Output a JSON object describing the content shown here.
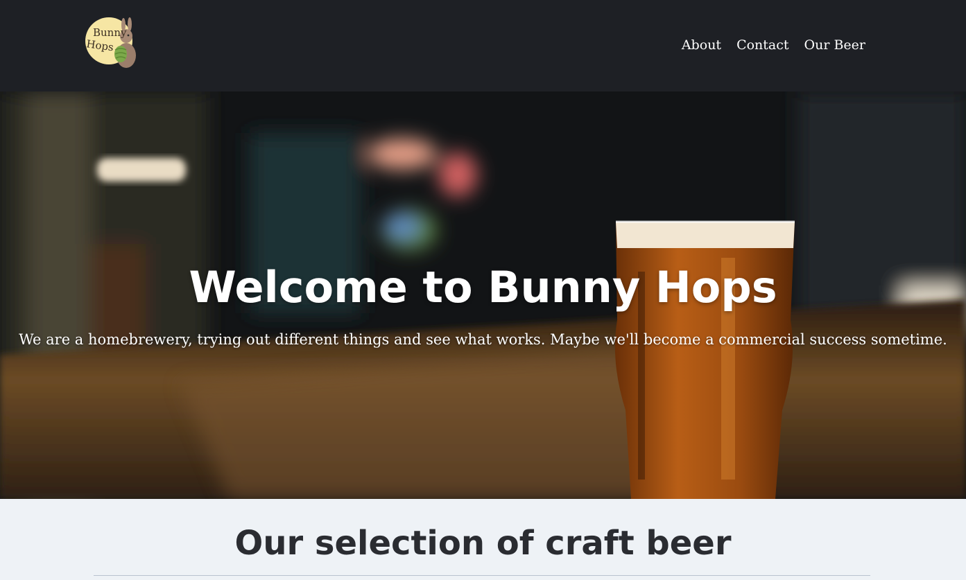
{
  "header": {
    "logo_text_line1": "Bunny",
    "logo_text_line2": "Hops",
    "nav": [
      {
        "label": "About"
      },
      {
        "label": "Contact"
      },
      {
        "label": "Our Beer"
      }
    ]
  },
  "hero": {
    "title": "Welcome to Bunny Hops",
    "subtitle": "We are a homebrewery, trying out different things and see what works. Maybe we'll become a commercial success sometime."
  },
  "section": {
    "title": "Our selection of craft beer"
  },
  "colors": {
    "header_bg": "#1e2025",
    "section_bg": "#eef2f6",
    "heading_text": "#2a2c31"
  }
}
